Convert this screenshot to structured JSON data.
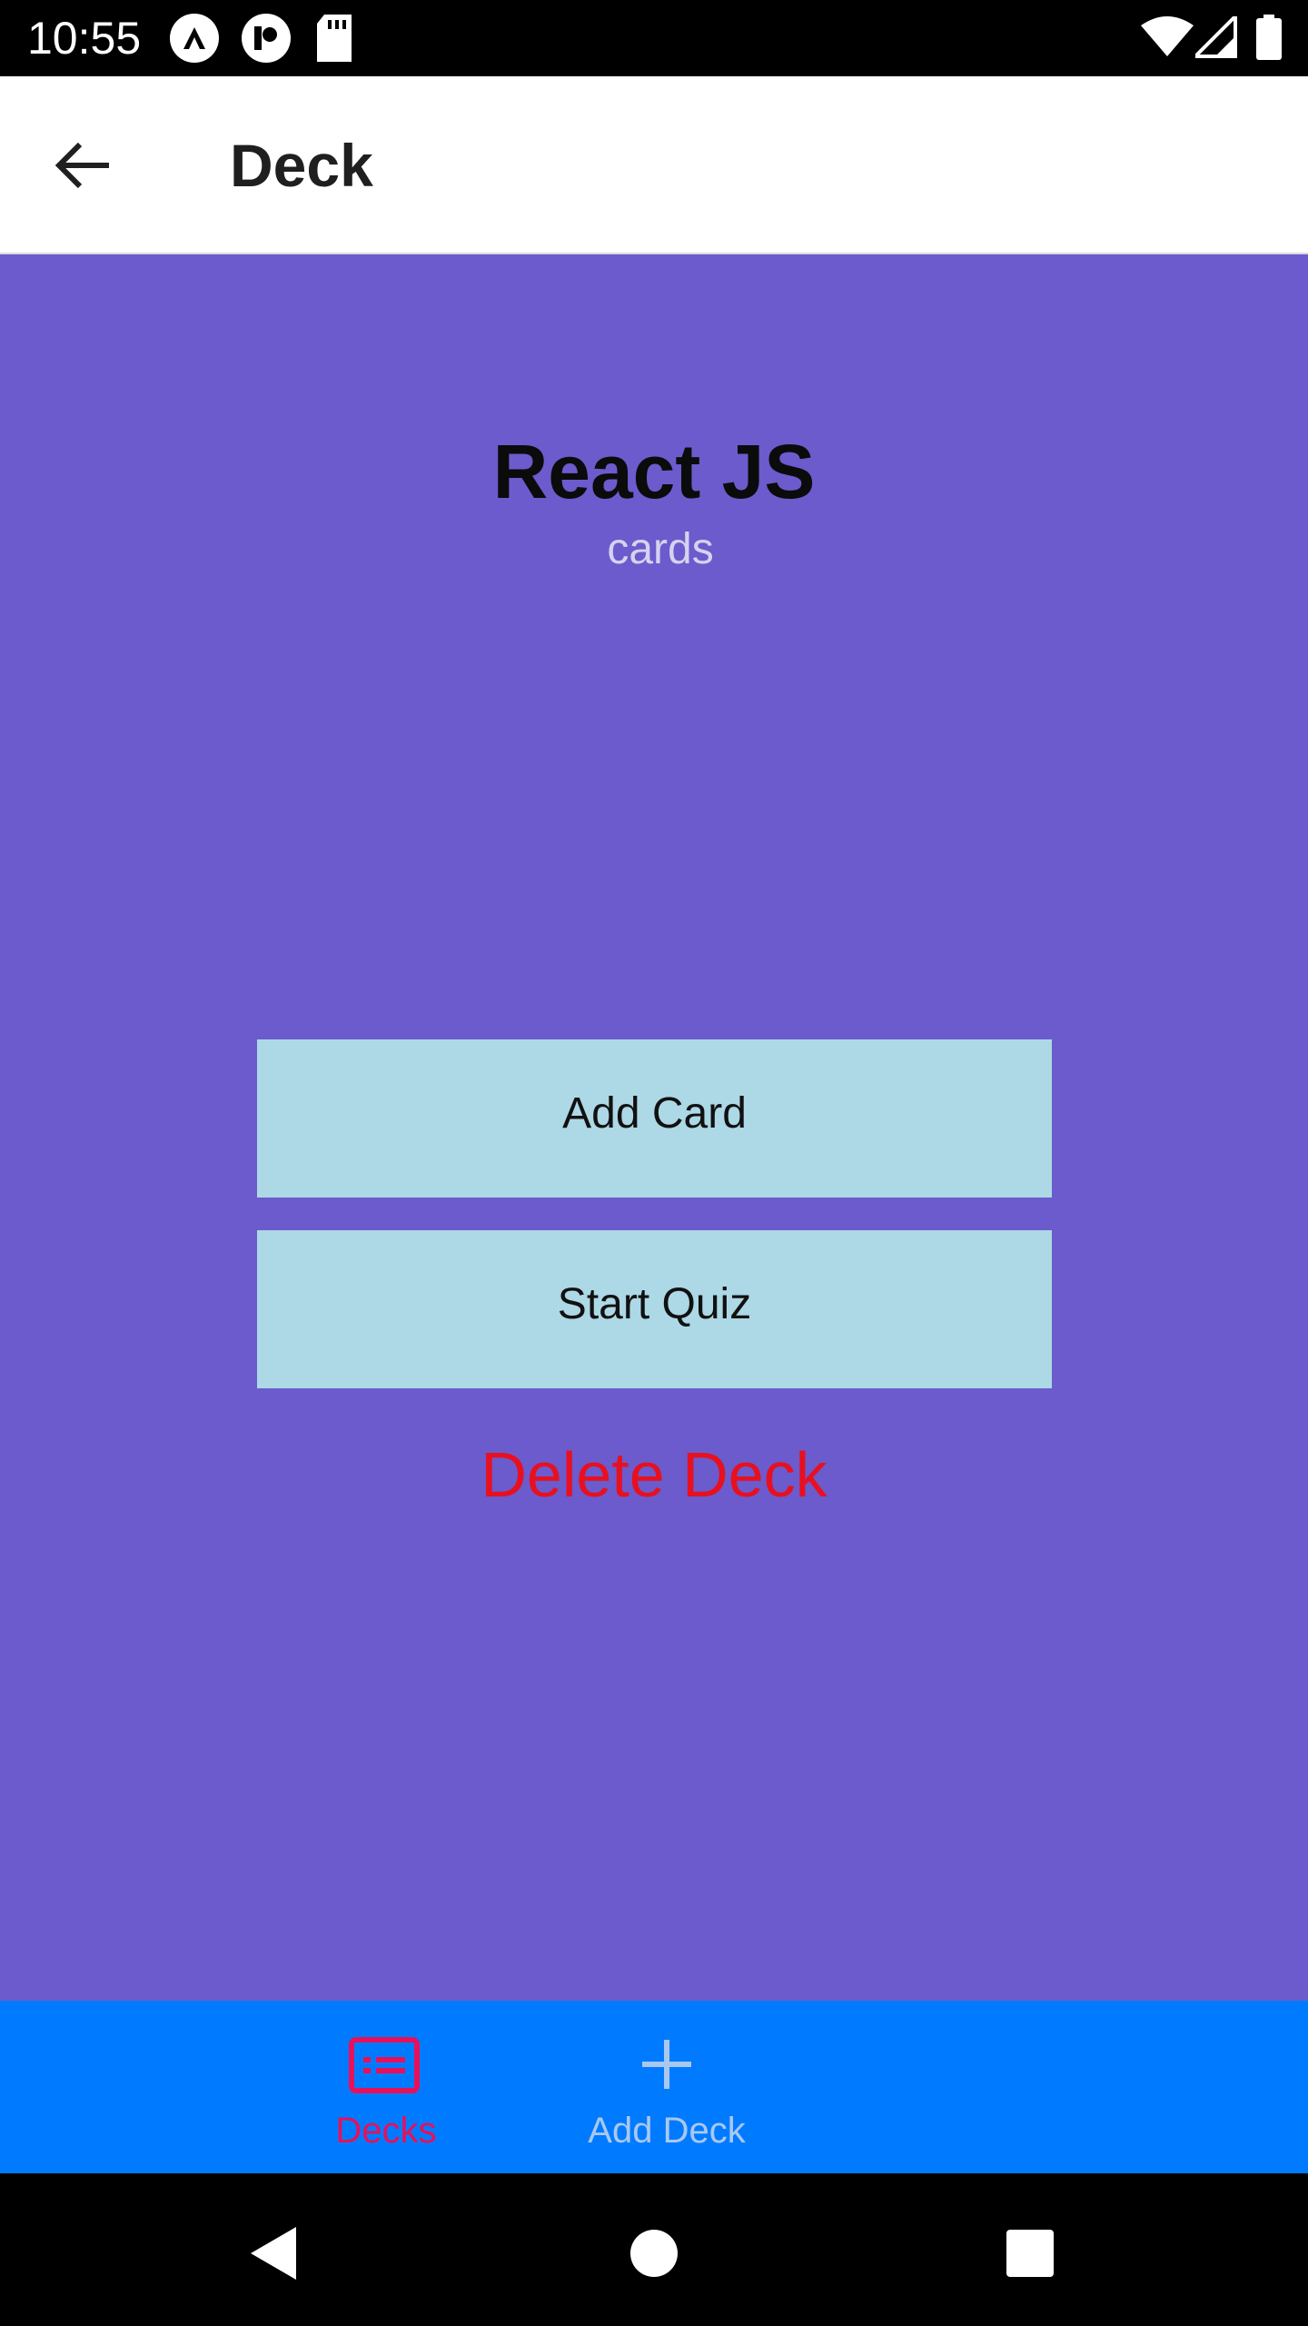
{
  "status_bar": {
    "time": "10:55",
    "icons": [
      "notification-a-icon",
      "notification-b-icon",
      "sd-card-icon",
      "wifi-icon",
      "signal-icon",
      "battery-icon"
    ]
  },
  "header": {
    "title": "Deck",
    "back_icon": "arrow-left-icon"
  },
  "deck": {
    "title": "React JS",
    "subtitle": "cards"
  },
  "actions": {
    "add_card_label": "Add Card",
    "start_quiz_label": "Start Quiz",
    "delete_deck_label": "Delete Deck"
  },
  "tabs": [
    {
      "label": "Decks",
      "icon": "cards-list-icon",
      "active": true
    },
    {
      "label": "Add Deck",
      "icon": "plus-icon",
      "active": false
    }
  ],
  "nav": {
    "buttons": [
      "back-triangle-icon",
      "home-circle-icon",
      "recents-square-icon"
    ]
  },
  "colors": {
    "main_background": "#6b5bcc",
    "button_background": "#add8e6",
    "delete_text": "#e8101e",
    "tab_bar_background": "#007bff",
    "active_tab": "#e8105a",
    "inactive_tab": "#a9c8ee"
  }
}
